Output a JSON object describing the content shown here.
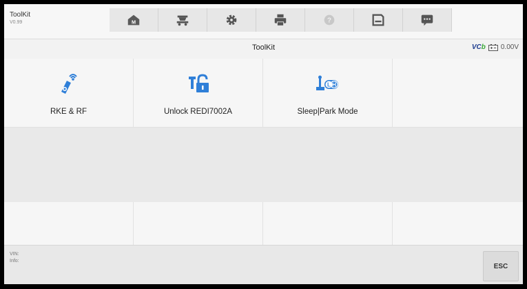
{
  "app": {
    "name": "ToolKit",
    "version": "V0.99"
  },
  "toolbar": {
    "buttons": [
      {
        "name": "home",
        "icon": "home-icon"
      },
      {
        "name": "vehicle",
        "icon": "car-lift-icon"
      },
      {
        "name": "settings",
        "icon": "gear-icon"
      },
      {
        "name": "print",
        "icon": "printer-icon"
      },
      {
        "name": "help",
        "icon": "help-icon"
      },
      {
        "name": "save",
        "icon": "save-icon"
      },
      {
        "name": "messages",
        "icon": "message-icon"
      }
    ]
  },
  "titlebar": {
    "title": "ToolKit",
    "vci_label": "VCI",
    "battery_voltage": "0.00V"
  },
  "tiles": [
    {
      "label": "RKE & RF",
      "icon": "rke-rf-icon"
    },
    {
      "label": "Unlock REDI7002A",
      "icon": "unlock-icon"
    },
    {
      "label": "Sleep|Park Mode",
      "icon": "sleep-park-mode-icon"
    }
  ],
  "footer": {
    "vin_label": "VIN:",
    "info_label": "Info:",
    "esc_label": "ESC"
  },
  "colors": {
    "accent": "#2f7fd8",
    "brand_green": "#3aa838",
    "brand_blue": "#1e3d8f"
  }
}
